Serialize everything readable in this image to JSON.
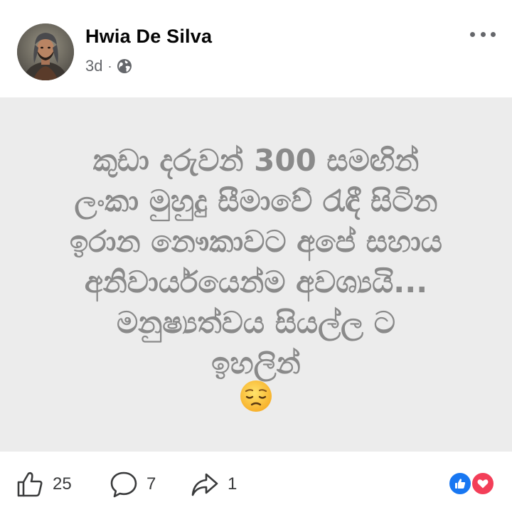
{
  "post": {
    "author": "Hwia De Silva",
    "timestamp": "3d",
    "separator": "·",
    "privacy_icon": "globe-icon",
    "more_icon": "more-options-icon"
  },
  "content": {
    "lines": [
      "කුඩා දරුවන් 300 සමඟින්",
      "ලංකා මුහුදු සීමාවේ රැඳී සිටින",
      "ඉරාන නෞකාවට අපේ සහාය",
      "අනිවාර්යයෙන්ම අවශ්‍යයි...",
      "මනුෂ්‍යත්වය සියල්ල ට",
      "ඉහලින්"
    ],
    "emoji": "pensive-face-emoji",
    "background_color": "#ececec",
    "text_color": "#8a8a8a"
  },
  "actions": {
    "likes": "25",
    "comments": "7",
    "shares": "1"
  },
  "reactions": [
    "like",
    "love"
  ],
  "colors": {
    "like_blue": "#1877f2",
    "love_red": "#f33e58",
    "meta_gray": "#65676b"
  }
}
